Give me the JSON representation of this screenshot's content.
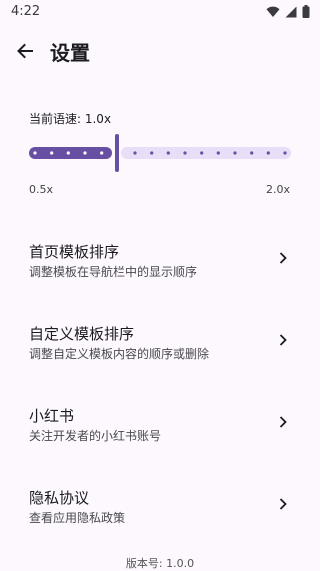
{
  "status_bar": {
    "time": "4:22"
  },
  "header": {
    "title": "设置"
  },
  "speed": {
    "label": "当前语速: 1.0x",
    "min_label": "0.5x",
    "max_label": "2.0x",
    "value": 1.0,
    "min": 0.5,
    "max": 2.0
  },
  "settings": [
    {
      "title": "首页模板排序",
      "subtitle": "调整模板在导航栏中的显示顺序"
    },
    {
      "title": "自定义模板排序",
      "subtitle": "调整自定义模板内容的顺序或删除"
    },
    {
      "title": "小红书",
      "subtitle": "关注开发者的小红书账号"
    },
    {
      "title": "隐私协议",
      "subtitle": "查看应用隐私政策"
    }
  ],
  "footer": {
    "version": "版本号: 1.0.0"
  },
  "colors": {
    "accent": "#6750a4",
    "track_inactive": "#e8def8",
    "background": "#fcf8fd"
  }
}
